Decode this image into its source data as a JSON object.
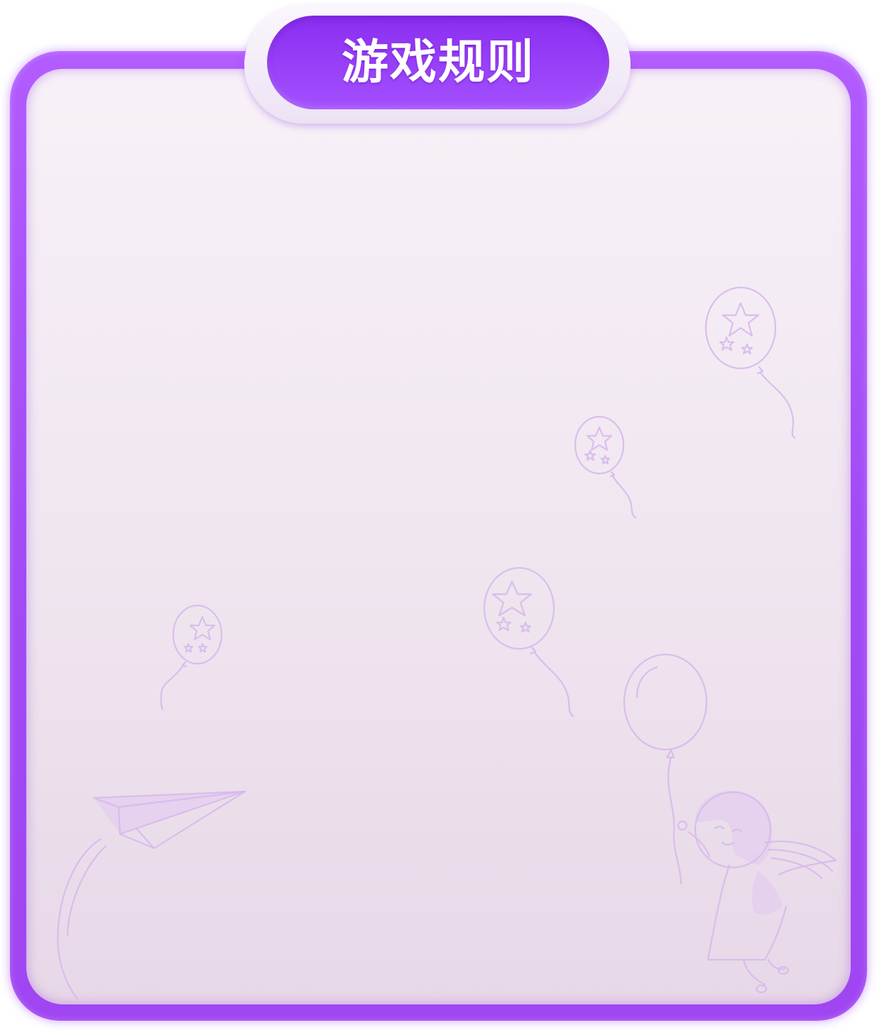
{
  "window": {
    "title": "游戏规则"
  },
  "decorations": [
    {
      "icon": "star-balloon-icon"
    },
    {
      "icon": "star-balloon-icon"
    },
    {
      "icon": "star-balloon-icon"
    },
    {
      "icon": "star-balloon-icon"
    },
    {
      "icon": "balloon-icon"
    },
    {
      "icon": "girl-illustration-icon"
    },
    {
      "icon": "paper-plane-icon"
    }
  ],
  "colors": {
    "frame": "#a24bf5",
    "title_pill": "#9b3ff8",
    "panel_top": "#f8f1f8",
    "panel_bottom": "#e7d8e7",
    "title_text": "#ffffff",
    "doodle": "#d7b9ec"
  }
}
